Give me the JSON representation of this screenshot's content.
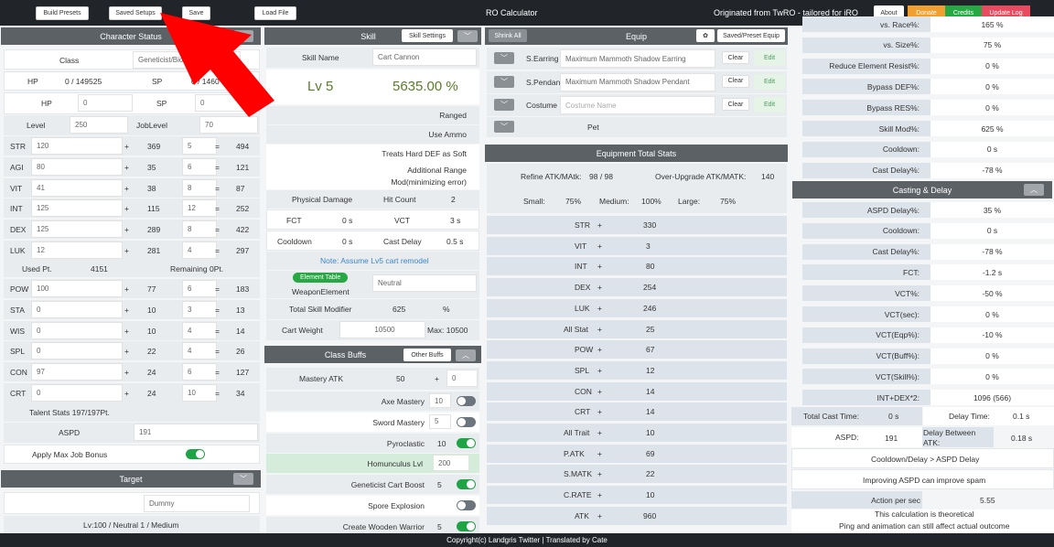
{
  "topbar": {
    "build_presets": "Build Presets",
    "saved_setups": "Saved Setups",
    "save": "Save",
    "load_file": "Load File",
    "title": "RO Calculator",
    "origin": "Originated from TwRO - tailored for iRO",
    "about": "About",
    "donate": "Donate",
    "credits": "Credits",
    "update_log": "Update Log"
  },
  "character": {
    "header": "Character Status",
    "class_label": "Class",
    "class_value": "Geneticist/Bio",
    "hp_label": "HP",
    "hp_value": "0 / 149525",
    "sp_label": "SP",
    "sp_value": "0 / 1460",
    "hp2_label": "HP",
    "hp2_value": "0",
    "sp2_label": "SP",
    "sp2_value": "0",
    "level_label": "Level",
    "level_value": "250",
    "joblevel_label": "JobLevel",
    "joblevel_value": "70",
    "stats": [
      {
        "name": "STR",
        "base": "120",
        "plus": "+",
        "bonus": "369",
        "job": "5",
        "eq": "=",
        "total": "494"
      },
      {
        "name": "AGI",
        "base": "80",
        "plus": "+",
        "bonus": "35",
        "job": "6",
        "eq": "=",
        "total": "121"
      },
      {
        "name": "VIT",
        "base": "41",
        "plus": "+",
        "bonus": "38",
        "job": "8",
        "eq": "=",
        "total": "87"
      },
      {
        "name": "INT",
        "base": "125",
        "plus": "+",
        "bonus": "115",
        "job": "12",
        "eq": "=",
        "total": "252"
      },
      {
        "name": "DEX",
        "base": "125",
        "plus": "+",
        "bonus": "289",
        "job": "8",
        "eq": "=",
        "total": "422"
      },
      {
        "name": "LUK",
        "base": "12",
        "plus": "+",
        "bonus": "281",
        "job": "4",
        "eq": "=",
        "total": "297"
      }
    ],
    "used_label": "Used Pt.",
    "used_value": "4151",
    "remaining": "Remaining 0Pt.",
    "traits": [
      {
        "name": "POW",
        "base": "100",
        "plus": "+",
        "bonus": "77",
        "job": "6",
        "eq": "=",
        "total": "183"
      },
      {
        "name": "STA",
        "base": "0",
        "plus": "+",
        "bonus": "10",
        "job": "3",
        "eq": "=",
        "total": "13"
      },
      {
        "name": "WIS",
        "base": "0",
        "plus": "+",
        "bonus": "10",
        "job": "4",
        "eq": "=",
        "total": "14"
      },
      {
        "name": "SPL",
        "base": "0",
        "plus": "+",
        "bonus": "22",
        "job": "4",
        "eq": "=",
        "total": "26"
      },
      {
        "name": "CON",
        "base": "97",
        "plus": "+",
        "bonus": "24",
        "job": "6",
        "eq": "=",
        "total": "127"
      },
      {
        "name": "CRT",
        "base": "0",
        "plus": "+",
        "bonus": "24",
        "job": "10",
        "eq": "=",
        "total": "34"
      }
    ],
    "talent": "Talent Stats 197/197Pt.",
    "aspd_label": "ASPD",
    "aspd_value": "191",
    "max_job": "Apply Max Job Bonus"
  },
  "target": {
    "header": "Target",
    "monster": "Dummy",
    "info": "Lv:100 / Neutral 1 / Medium"
  },
  "skill": {
    "header": "Skill",
    "settings": "Skill Settings",
    "name_label": "Skill Name",
    "name_value": "Cart Cannon",
    "level": "Lv 5",
    "percent": "5635.00 %",
    "tags": [
      "Ranged",
      "Use Ammo",
      "Treats Hard DEF as Soft",
      "Additional Range",
      "Mod(minimizing error)"
    ],
    "physical": "Physical Damage",
    "hitcount_label": "Hit Count",
    "hitcount_value": "2",
    "fct_label": "FCT",
    "fct_value": "0 s",
    "vct_label": "VCT",
    "vct_value": "3 s",
    "cooldown_label": "Cooldown",
    "cooldown_value": "0 s",
    "castdelay_label": "Cast Delay",
    "castdelay_value": "0.5 s",
    "note": "Note: Assume Lv5 cart remodel",
    "element_table": "Element Table",
    "weapon_element": "WeaponElement",
    "element_value": "Neutral",
    "total_mod_label": "Total Skill Modifier",
    "total_mod_value": "625",
    "total_mod_unit": "%",
    "cart_label": "Cart Weight",
    "cart_value": "10500",
    "cart_max": "Max: 10500"
  },
  "buffs": {
    "header": "Class Buffs",
    "other": "Other Buffs",
    "mastery_label": "Mastery ATK",
    "mastery_value": "50",
    "mastery_plus": "+",
    "mastery_extra": "0",
    "items": [
      {
        "label": "Axe Mastery",
        "value": "10",
        "state": "off"
      },
      {
        "label": "Sword Mastery",
        "value": "5",
        "state": "off"
      },
      {
        "label": "Pyroclastic",
        "value": "10",
        "state": "on"
      },
      {
        "label": "Homunculus Lvl",
        "value": "200",
        "state": "none"
      },
      {
        "label": "Geneticist Cart Boost",
        "value": "5",
        "state": "on"
      },
      {
        "label": "Spore Explosion",
        "value": "",
        "state": "off"
      },
      {
        "label": "Create Wooden Warrior",
        "value": "5",
        "state": "on"
      }
    ]
  },
  "equip": {
    "shrink": "Shrink All",
    "header": "Equip",
    "gear": "✿",
    "preset": "Saved/Preset Equip",
    "slots": [
      {
        "label": "S.Earring",
        "value": "Maximum Mammoth Shadow Earring",
        "clear": "Clear",
        "edit": "Edit"
      },
      {
        "label": "S.Pendant",
        "value": "Maximum Mammoth Shadow Pendant",
        "clear": "Clear",
        "edit": "Edit"
      },
      {
        "label": "Costume",
        "placeholder": "Costume Name",
        "clear": "Clear",
        "edit": "Edit"
      }
    ],
    "pet": "Pet",
    "totals_header": "Equipment Total Stats",
    "refine_label": "Refine ATK/MAtk:",
    "refine_value": "98 / 98",
    "overupgrade_label": "Over-Upgrade ATK/MATK:",
    "overupgrade_value": "140",
    "small_label": "Small:",
    "small_value": "75%",
    "medium_label": "Medium:",
    "medium_value": "100%",
    "large_label": "Large:",
    "large_value": "75%",
    "stats": [
      {
        "name": "STR",
        "plus": "+",
        "value": "330"
      },
      {
        "name": "VIT",
        "plus": "+",
        "value": "3"
      },
      {
        "name": "INT",
        "plus": "+",
        "value": "80"
      },
      {
        "name": "DEX",
        "plus": "+",
        "value": "254"
      },
      {
        "name": "LUK",
        "plus": "+",
        "value": "246"
      },
      {
        "name": "All Stat",
        "plus": "+",
        "value": "25"
      },
      {
        "name": "POW",
        "plus": "+",
        "value": "67"
      },
      {
        "name": "SPL",
        "plus": "+",
        "value": "12"
      },
      {
        "name": "CON",
        "plus": "+",
        "value": "14"
      },
      {
        "name": "CRT",
        "plus": "+",
        "value": "14"
      },
      {
        "name": "All Trait",
        "plus": "+",
        "value": "10"
      },
      {
        "name": "P.ATK",
        "plus": "+",
        "value": "69"
      },
      {
        "name": "S.MATK",
        "plus": "+",
        "value": "22"
      },
      {
        "name": "C.RATE",
        "plus": "+",
        "value": "10"
      },
      {
        "name": "ATK",
        "plus": "+",
        "value": "960"
      }
    ]
  },
  "rightcol": {
    "top": [
      {
        "label": "vs. Race%:",
        "value": "165 %"
      },
      {
        "label": "vs. Size%:",
        "value": "75 %"
      },
      {
        "label": "Reduce Element Resist%:",
        "value": "0 %"
      },
      {
        "label": "Bypass DEF%:",
        "value": "0 %"
      },
      {
        "label": "Bypass RES%:",
        "value": "0 %"
      },
      {
        "label": "Skill Mod%:",
        "value": "625 %"
      },
      {
        "label": "Cooldown:",
        "value": "0 s"
      },
      {
        "label": "Cast Delay%:",
        "value": "-78 %"
      }
    ],
    "casting_header": "Casting & Delay",
    "casting": [
      {
        "label": "ASPD Delay%:",
        "value": "35 %"
      },
      {
        "label": "Cooldown:",
        "value": "0 s"
      },
      {
        "label": "Cast Delay%:",
        "value": "-78 %"
      },
      {
        "label": "FCT:",
        "value": "-1.2 s"
      },
      {
        "label": "VCT%:",
        "value": "-50 %"
      },
      {
        "label": "VCT(sec):",
        "value": "0 %"
      },
      {
        "label": "VCT(Eqp%):",
        "value": "-10 %"
      },
      {
        "label": "VCT(Buff%):",
        "value": "0 %"
      },
      {
        "label": "VCT(Skill%):",
        "value": "0 %"
      },
      {
        "label": "INT+DEX*2:",
        "value": "1096 (566)"
      }
    ],
    "total_cast_label": "Total Cast Time:",
    "total_cast_value": "0 s",
    "delay_time_label": "Delay Time:",
    "delay_time_value": "0.1 s",
    "aspd_label": "ASPD:",
    "aspd_value": "191",
    "delay_between_label": "Delay Between ATK:",
    "delay_between_value": "0.18 s",
    "cd_vs_aspd": "Cooldown/Delay > ASPD Delay",
    "improving": "Improving ASPD can improve spam",
    "aps_label": "Action per sec",
    "aps_value": "5.55",
    "note1": "This calculation is theoretical",
    "note2": "Ping and animation can still affect actual outcome"
  },
  "footer": "Copyright(c) Landgris Twitter | Translated by Cate",
  "colors": {
    "topbar": "#212529",
    "header": "#5c6166",
    "toggle_on": "#1ea444",
    "arrow": "#ff0000",
    "donate": "#f0a031",
    "credits": "#28a745",
    "update": "#e84a5f"
  }
}
